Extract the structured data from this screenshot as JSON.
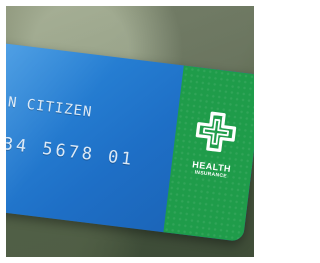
{
  "card": {
    "holder_name": "N CITIZEN",
    "number_label": "",
    "card_number": "34 5678 01",
    "brand_title": "HEALTH",
    "brand_subtitle": "INSURANCE"
  },
  "colors": {
    "card_blue": "#1e6fc6",
    "panel_green": "#1f9c4a",
    "text_light": "#dbe9f7"
  },
  "icons": {
    "logo": "medical-cross-icon"
  }
}
